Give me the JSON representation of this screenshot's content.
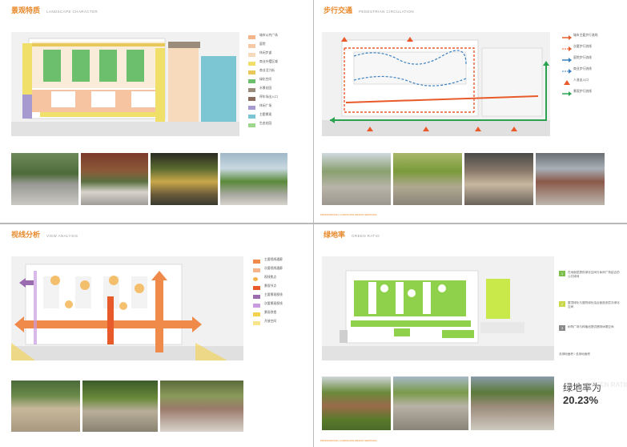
{
  "pages": [
    {
      "title": "景观特质",
      "subtitle": "LANDSCAPE CHARACTER",
      "legend": [
        {
          "label": "城市公共广场",
          "color": "#f4b58a"
        },
        {
          "label": "庭院",
          "color": "#f6c9a4"
        },
        {
          "label": "休闲步道",
          "color": "#f7d9bc"
        },
        {
          "label": "商业外摆区域",
          "color": "#f0e06a"
        },
        {
          "label": "商业活力街",
          "color": "#e9c85a"
        },
        {
          "label": "绿化空间",
          "color": "#6bbf6d"
        },
        {
          "label": "水景花园",
          "color": "#9b8b7b"
        },
        {
          "label": "停车场出入口",
          "color": "#8b6b5b"
        },
        {
          "label": "休闲广场",
          "color": "#a79ad0"
        },
        {
          "label": "主题景观",
          "color": "#7cc6d4"
        },
        {
          "label": "生态花园",
          "color": "#9ed68e"
        }
      ]
    },
    {
      "title": "步行交通",
      "subtitle": "PEDESTRIAN CIRCULATION",
      "legend": [
        {
          "label": "城市主要步行流线",
          "color": "#e85a2a"
        },
        {
          "label": "次要步行流线",
          "color": "#e85a2a"
        },
        {
          "label": "庭院步行流线",
          "color": "#3a7fc0"
        },
        {
          "label": "商业步行流线",
          "color": "#3a7fc0"
        },
        {
          "label": "人流出入口",
          "color": "#e85a2a"
        },
        {
          "label": "景观步行流线",
          "color": "#2aa350"
        }
      ],
      "footer": "PROFESSIONAL LANDSCAPE DESIGN SERVICES"
    },
    {
      "title": "视线分析",
      "subtitle": "VIEW ANALYSIS",
      "legend": [
        {
          "label": "主要视线通廊",
          "color": "#f08a4b"
        },
        {
          "label": "次要视线通廊",
          "color": "#f08a4b"
        },
        {
          "label": "视线焦点",
          "color": "#f4b24b"
        },
        {
          "label": "景观节点",
          "color": "#e85a2a"
        },
        {
          "label": "主要景观视线",
          "color": "#9b6bb0"
        },
        {
          "label": "次要景观视线",
          "color": "#c99be0"
        },
        {
          "label": "景观渗透",
          "color": "#f4d24b"
        },
        {
          "label": "开放空间",
          "color": "#f4d24b"
        }
      ]
    },
    {
      "title": "绿地率",
      "subtitle": "GREEN RATIO",
      "notes": [
        {
          "badge": "1",
          "color": "#7cbf4a",
          "text": "在地面层提供绿化空间与休闲广场结合的公共绿地"
        },
        {
          "badge": "2",
          "color": "#c9d84a",
          "text": "屋顶绿化与庭院绿化结合营造多层次绿化空间"
        },
        {
          "badge": "3",
          "color": "#8a8a8a",
          "text": "树阵广场与种植池提供遮阴休憩空间"
        },
        {
          "badge": "",
          "color": "#ffffff",
          "text": "总绿地面积 / 总用地面积"
        }
      ],
      "ratio_label": "绿地率为",
      "ratio_value": "20.23%",
      "ratio_en": "GREEN RATIO",
      "footer": "PROFESSIONAL LANDSCAPE DESIGN SERVICES"
    }
  ]
}
